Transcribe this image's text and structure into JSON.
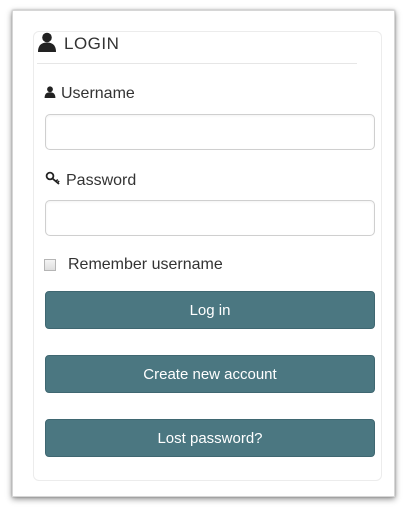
{
  "header": {
    "title": "LOGIN",
    "icon": "user-icon"
  },
  "username": {
    "label": "Username",
    "icon": "user-icon",
    "value": "",
    "placeholder": ""
  },
  "password": {
    "label": "Password",
    "icon": "key-icon",
    "value": "",
    "placeholder": ""
  },
  "remember": {
    "label": "Remember username",
    "checked": false
  },
  "buttons": {
    "login": "Log in",
    "create_account": "Create new account",
    "lost_password": "Lost password?"
  },
  "colors": {
    "button_bg": "#4b7781",
    "text": "#333333"
  }
}
